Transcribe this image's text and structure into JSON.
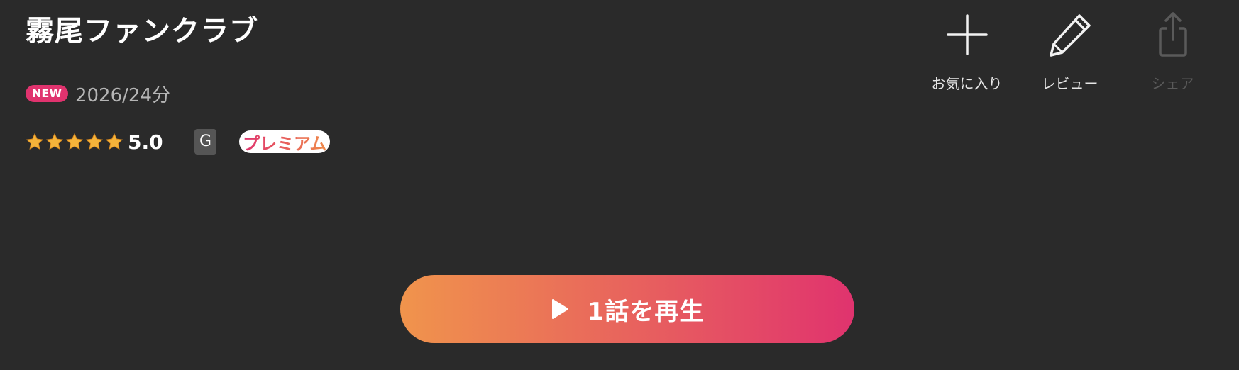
{
  "title": "霧尾ファンクラブ",
  "meta": {
    "new_badge": "NEW",
    "info": "2026/24分"
  },
  "rating": {
    "stars": 5,
    "value": "5.0",
    "star_color": "#f5b33a"
  },
  "age_rating": "G",
  "premium_label": "プレミアム",
  "actions": [
    {
      "label": "お気に入り",
      "icon": "plus-icon",
      "enabled": true
    },
    {
      "label": "レビュー",
      "icon": "pencil-icon",
      "enabled": true
    },
    {
      "label": "シェア",
      "icon": "share-icon",
      "enabled": false
    }
  ],
  "play_button": {
    "label": "1話を再生",
    "icon": "play-icon"
  },
  "colors": {
    "background": "#2a2a2a",
    "accent_start": "#f0944c",
    "accent_end": "#e0336e",
    "new_badge": "#e0336e"
  }
}
